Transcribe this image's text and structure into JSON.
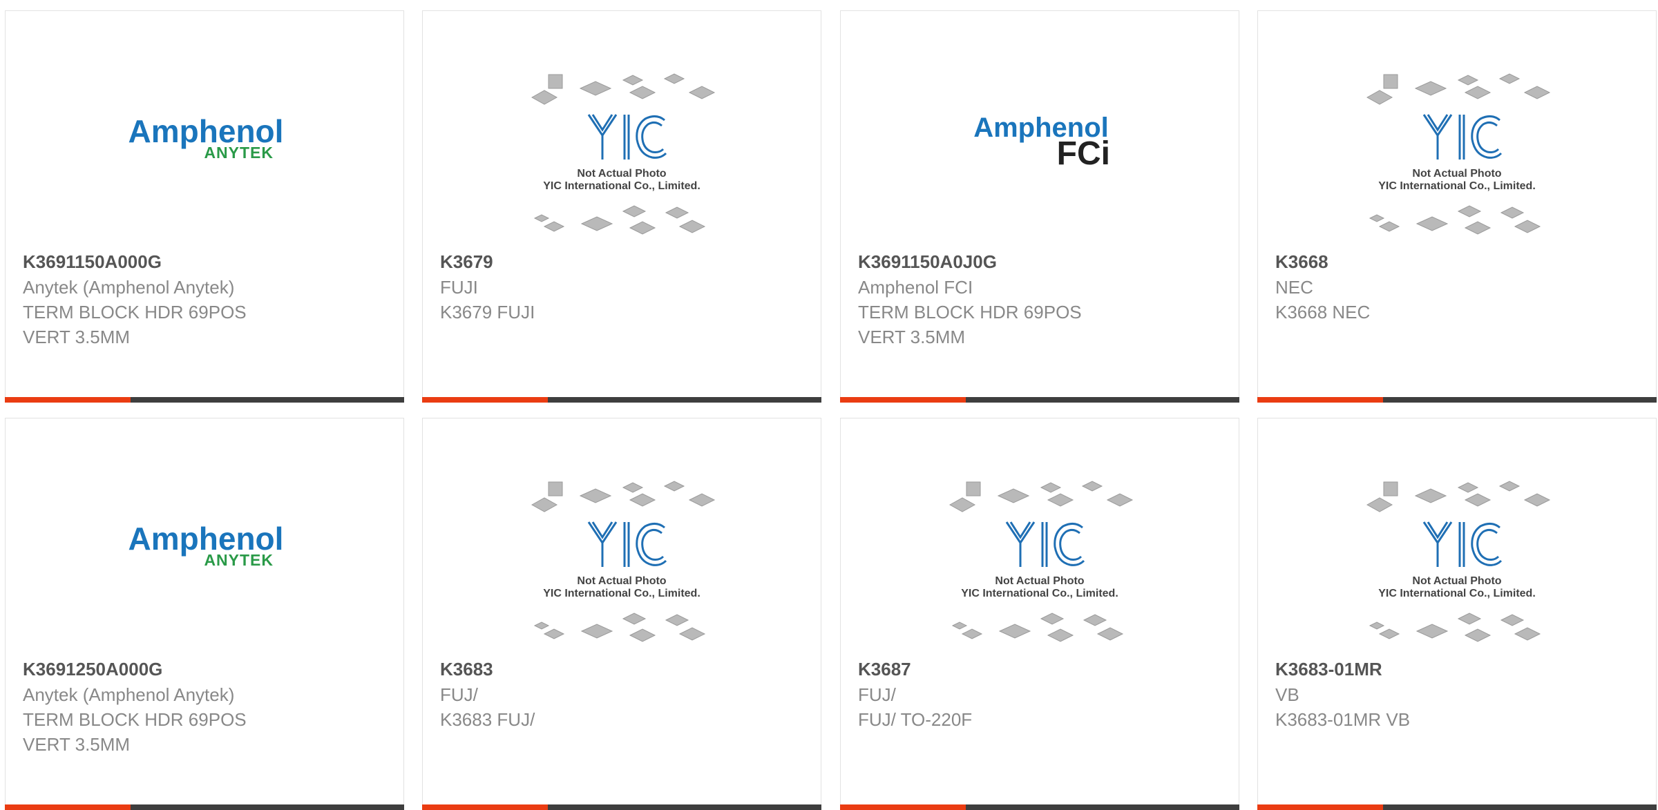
{
  "products": [
    {
      "part_number": "K3691150A000G",
      "manufacturer": "Anytek (Amphenol Anytek)",
      "desc1": "TERM BLOCK HDR 69POS",
      "desc2": "VERT 3.5MM",
      "image": "amphenol-anytek-logo"
    },
    {
      "part_number": "K3679",
      "manufacturer": "FUJI",
      "desc1": "K3679 FUJI",
      "desc2": "",
      "image": "yic-placeholder"
    },
    {
      "part_number": "K3691150A0J0G",
      "manufacturer": "Amphenol FCI",
      "desc1": "TERM BLOCK HDR 69POS",
      "desc2": "VERT 3.5MM",
      "image": "amphenol-fci-logo"
    },
    {
      "part_number": "K3668",
      "manufacturer": "NEC",
      "desc1": "K3668 NEC",
      "desc2": "",
      "image": "yic-placeholder"
    },
    {
      "part_number": "K3691250A000G",
      "manufacturer": "Anytek (Amphenol Anytek)",
      "desc1": "TERM BLOCK HDR 69POS",
      "desc2": "VERT 3.5MM",
      "image": "amphenol-anytek-logo"
    },
    {
      "part_number": "K3683",
      "manufacturer": "FUJ/",
      "desc1": "K3683 FUJ/",
      "desc2": "",
      "image": "yic-placeholder"
    },
    {
      "part_number": "K3687",
      "manufacturer": "FUJ/",
      "desc1": "FUJ/ TO-220F",
      "desc2": "",
      "image": "yic-placeholder"
    },
    {
      "part_number": "K3683-01MR",
      "manufacturer": "VB",
      "desc1": "K3683-01MR VB",
      "desc2": "",
      "image": "yic-placeholder"
    }
  ],
  "logos": {
    "amphenol": "Amphenol",
    "anytek": "ANYTEK",
    "fci": "FCi",
    "yic_line1": "Not Actual Photo",
    "yic_line2": "YIC International Co., Limited."
  },
  "colors": {
    "accent": "#ea3c12",
    "bar": "#3e3e3e",
    "amphenol_blue": "#1a75bc",
    "anytek_green": "#2a9a48",
    "yic_blue": "#1f6fb4"
  }
}
